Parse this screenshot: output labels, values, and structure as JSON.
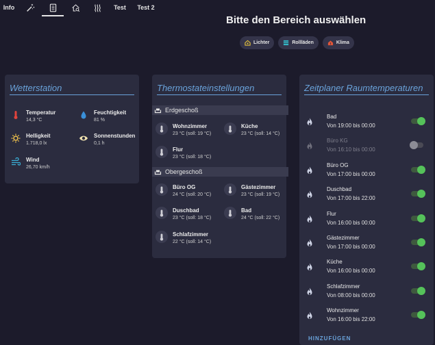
{
  "tabs": [
    {
      "label": "Info",
      "icon": "",
      "active": false
    },
    {
      "label": "",
      "icon": "magic-wand-icon",
      "active": false
    },
    {
      "label": "",
      "icon": "document-icon",
      "active": true
    },
    {
      "label": "",
      "icon": "home-search-icon",
      "active": false
    },
    {
      "label": "",
      "icon": "heat-waves-icon",
      "active": false
    },
    {
      "label": "Test",
      "icon": "",
      "active": false
    },
    {
      "label": "Test 2",
      "icon": "",
      "active": false
    }
  ],
  "header": {
    "title": "Bitte den Bereich auswählen",
    "chips": [
      {
        "label": "Lichter",
        "icon": "home-light-icon",
        "color": "#e8c53a"
      },
      {
        "label": "Rollläden",
        "icon": "blinds-icon",
        "color": "#35b6c6"
      },
      {
        "label": "Klima",
        "icon": "climate-icon",
        "color": "#e05538"
      }
    ]
  },
  "weather": {
    "title": "Wetterstation",
    "items": [
      {
        "name": "Temperatur",
        "value": "14,3 °C",
        "icon": "thermometer-icon",
        "color": "#e0433c"
      },
      {
        "name": "Feuchtigkeit",
        "value": "81 %",
        "icon": "water-drop-icon",
        "color": "#3a90d9"
      },
      {
        "name": "Helligkeit",
        "value": "1.718,0 lx",
        "icon": "sun-icon",
        "color": "#f1c34c"
      },
      {
        "name": "Sonnenstunden",
        "value": "0,1 h",
        "icon": "eye-icon",
        "color": "#f2e3b0"
      },
      {
        "name": "Wind",
        "value": "26,70 km/h",
        "icon": "wind-icon",
        "color": "#3ab0d8"
      }
    ]
  },
  "thermostat": {
    "title": "Thermostateinstellungen",
    "floors": [
      {
        "name": "Erdgeschoß",
        "rooms": [
          {
            "name": "Wohnzimmer",
            "value": "23 °C (soll: 19 °C)"
          },
          {
            "name": "Küche",
            "value": "23 °C (soll: 14 °C)"
          },
          {
            "name": "Flur",
            "value": "23 °C (soll: 18 °C)"
          }
        ]
      },
      {
        "name": "Obergeschoß",
        "rooms": [
          {
            "name": "Büro OG",
            "value": "24 °C (soll: 20 °C)"
          },
          {
            "name": "Gästezimmer",
            "value": "23 °C (soll: 19 °C)"
          },
          {
            "name": "Duschbad",
            "value": "23 °C (soll: 18 °C)"
          },
          {
            "name": "Bad",
            "value": "24 °C (soll: 22 °C)"
          },
          {
            "name": "Schlafzimmer",
            "value": "22 °C (soll: 14 °C)"
          }
        ]
      }
    ]
  },
  "scheduler": {
    "title": "Zeitplaner Raumtemperaturen",
    "items": [
      {
        "name": "Bad",
        "time": "Von 19:00 bis 00:00",
        "enabled": true
      },
      {
        "name": "Büro KG",
        "time": "Von 16:10 bis 00:00",
        "enabled": false
      },
      {
        "name": "Büro OG",
        "time": "Von 17:00 bis 00:00",
        "enabled": true
      },
      {
        "name": "Duschbad",
        "time": "Von 17:00 bis 22:00",
        "enabled": true
      },
      {
        "name": "Flur",
        "time": "Von 16:00 bis 00:00",
        "enabled": true
      },
      {
        "name": "Gästezimmer",
        "time": "Von 17:00 bis 00:00",
        "enabled": true
      },
      {
        "name": "Küche",
        "time": "Von 16:00 bis 00:00",
        "enabled": true
      },
      {
        "name": "Schlafzimmer",
        "time": "Von 08:00 bis 00:00",
        "enabled": true
      },
      {
        "name": "Wohnzimmer",
        "time": "Von 16:00 bis 22:00",
        "enabled": true
      }
    ],
    "add_label": "HINZUFÜGEN"
  }
}
